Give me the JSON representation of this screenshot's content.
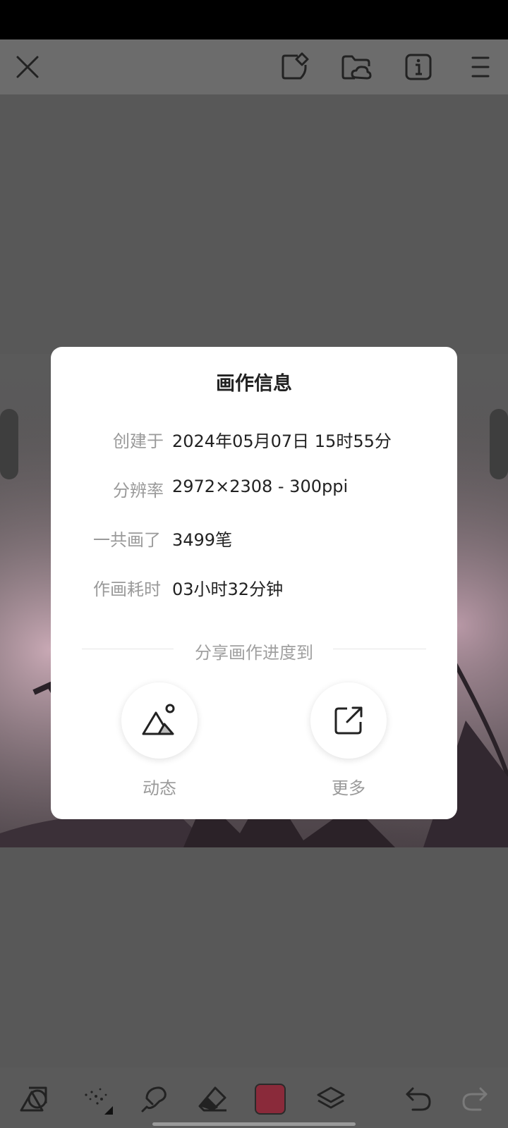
{
  "dialog": {
    "title": "画作信息",
    "rows": [
      {
        "label": "创建于",
        "value": "2024年05月07日 15时55分"
      },
      {
        "label": "分辨率",
        "value": "2972×2308 - 300ppi"
      },
      {
        "label": "一共画了",
        "value": "3499笔"
      },
      {
        "label": "作画耗时",
        "value": "03小时32分钟"
      }
    ],
    "share_caption": "分享画作进度到",
    "share_targets": [
      {
        "label": "动态",
        "icon": "mountain-image-icon"
      },
      {
        "label": "更多",
        "icon": "external-share-icon"
      }
    ]
  },
  "toolbar_icons": [
    "close-icon",
    "sticker-icon",
    "cloud-folder-icon",
    "info-icon",
    "menu-icon"
  ],
  "bottom_tools": [
    "shape-icon",
    "brush-scatter-icon",
    "smudge-icon",
    "eraser-icon",
    "color-swatch",
    "layers-icon",
    "undo-icon",
    "redo-icon"
  ],
  "colors": {
    "current_color": "#8a2a3a",
    "overlay": "#585858",
    "dialog_bg": "#ffffff"
  }
}
